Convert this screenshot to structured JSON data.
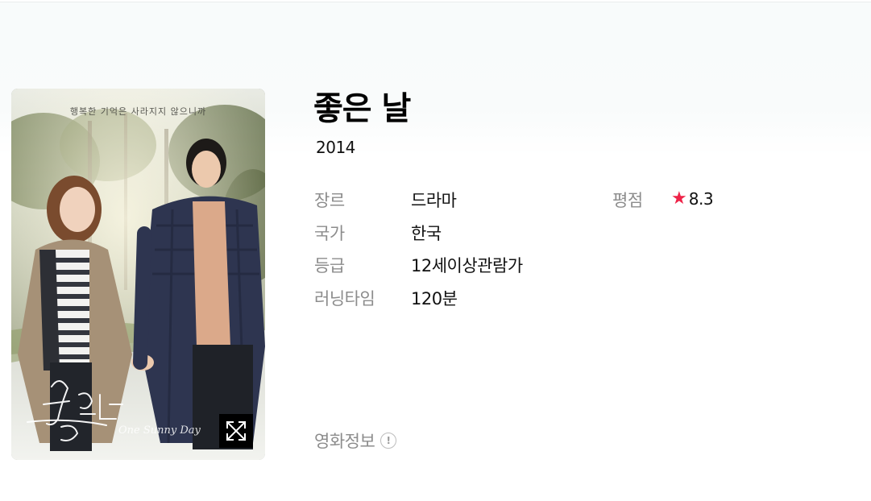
{
  "poster": {
    "tagline": "행복한 기억은 사라지지 않으니까",
    "title_calligraphy": "좋은날",
    "subtitle_script": "One Sunny Day",
    "expand_icon": "expand-arrows-icon"
  },
  "movie": {
    "title": "좋은 날",
    "year": "2014"
  },
  "details": {
    "genre_label": "장르",
    "genre_value": "드라마",
    "country_label": "국가",
    "country_value": "한국",
    "rating_label": "등급",
    "rating_value": "12세이상관람가",
    "runtime_label": "러닝타임",
    "runtime_value": "120분",
    "score_label": "평점",
    "score_icon": "star-icon",
    "score_value": "8.3"
  },
  "footer": {
    "info_label": "영화정보",
    "info_icon_glyph": "!"
  },
  "colors": {
    "star": "#ee2348",
    "label": "#8c8c8c",
    "text": "#111111"
  }
}
